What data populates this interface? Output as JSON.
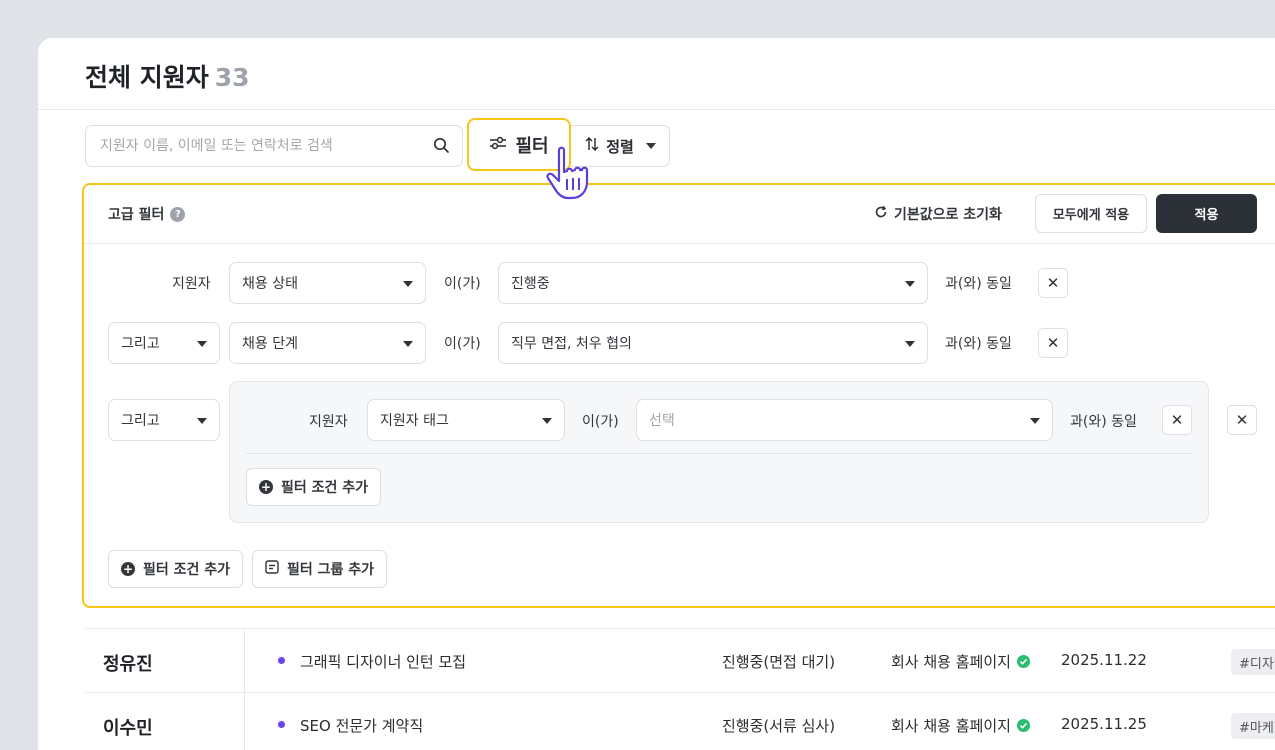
{
  "header": {
    "title": "전체 지원자",
    "count": "33"
  },
  "search": {
    "placeholder": "지원자 이름, 이메일 또는 연락처로 검색",
    "icon": "search-icon"
  },
  "toolbar": {
    "filter_label": "필터",
    "sort_label": "정렬"
  },
  "advanced_filter": {
    "title": "고급 필터",
    "reset_label": "기본값으로 초기화",
    "apply_all_label": "모두에게 적용",
    "apply_label": "적용",
    "rows": [
      {
        "subject": "지원자",
        "field": "채용 상태",
        "operator": "이(가)",
        "value": "진행중",
        "suffix": "과(와) 동일"
      },
      {
        "connector": "그리고",
        "field": "채용 단계",
        "operator": "이(가)",
        "value": "직무 면접, 처우 협의",
        "suffix": "과(와) 동일"
      }
    ],
    "group": {
      "connector": "그리고",
      "subject": "지원자",
      "field": "지원자 태그",
      "operator": "이(가)",
      "value_placeholder": "선택",
      "suffix": "과(와) 동일",
      "add_condition_label": "필터 조건 추가"
    },
    "add_condition_label": "필터 조건 추가",
    "add_group_label": "필터 그룹 추가"
  },
  "applicants": [
    {
      "name": "정유진",
      "job": "그래픽 디자이너 인턴 모집",
      "status": "진행중(면접 대기)",
      "source": "회사 채용 홈페이지",
      "date": "2025.11.22",
      "tag": "#디자인"
    },
    {
      "name": "이수민",
      "job": "SEO 전문가 계약직",
      "status": "진행중(서류 심사)",
      "source": "회사 채용 홈페이지",
      "date": "2025.11.25",
      "tag": "#마케팅"
    }
  ],
  "colors": {
    "highlight": "#f5c518",
    "primary_dark": "#2c3138",
    "job_dot": "#6a43f2",
    "verified": "#2dbd72"
  }
}
